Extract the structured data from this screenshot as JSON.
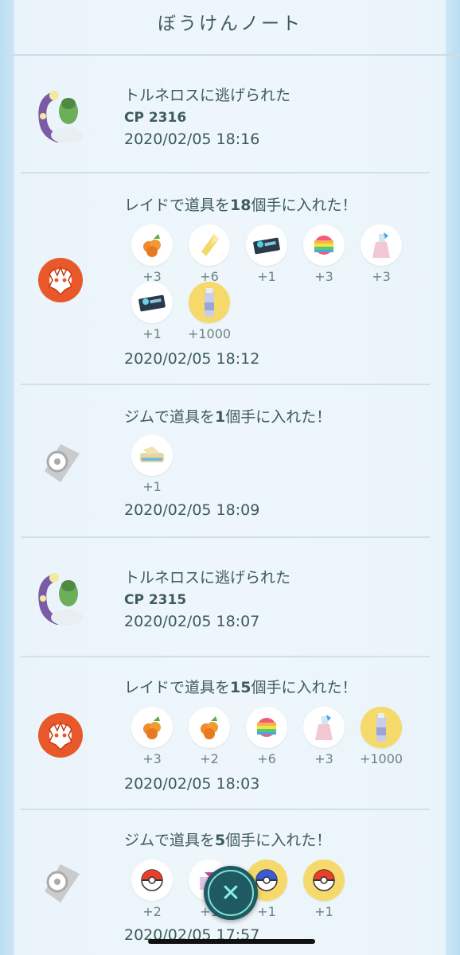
{
  "header": {
    "title": "ぼうけんノート"
  },
  "entries": [
    {
      "type": "flee",
      "pre": "トルネロスに逃げられた",
      "cp": "CP 2316",
      "date": "2020/02/05 18:16"
    },
    {
      "type": "raid",
      "pre": "レイドで道具を",
      "count": "18",
      "post": "個手に入れた！",
      "date": "2020/02/05 18:12",
      "items": [
        {
          "icon": "golden-razz-berry-icon",
          "qty": "+3"
        },
        {
          "icon": "rare-candy-icon",
          "qty": "+6"
        },
        {
          "icon": "technical-machine-icon",
          "qty": "+1"
        },
        {
          "icon": "rare-candy-rainbow-icon",
          "qty": "+3"
        },
        {
          "icon": "max-revive-icon",
          "qty": "+3"
        },
        {
          "icon": "technical-machine-icon",
          "qty": "+1"
        },
        {
          "icon": "stardust-potion-icon",
          "qty": "+1000"
        }
      ]
    },
    {
      "type": "gym",
      "pre": "ジムで道具を",
      "count": "1",
      "post": "個手に入れた！",
      "date": "2020/02/05 18:09",
      "items": [
        {
          "icon": "pinap-berry-icon",
          "qty": "+1"
        }
      ]
    },
    {
      "type": "flee",
      "pre": "トルネロスに逃げられた",
      "cp": "CP 2315",
      "date": "2020/02/05 18:07"
    },
    {
      "type": "raid",
      "pre": "レイドで道具を",
      "count": "15",
      "post": "個手に入れた！",
      "date": "2020/02/05 18:03",
      "items": [
        {
          "icon": "golden-razz-berry-icon",
          "qty": "+3"
        },
        {
          "icon": "golden-razz-berry-icon",
          "qty": "+2"
        },
        {
          "icon": "rare-candy-rainbow-icon",
          "qty": "+6"
        },
        {
          "icon": "max-revive-icon",
          "qty": "+3"
        },
        {
          "icon": "stardust-potion-icon",
          "qty": "+1000"
        }
      ]
    },
    {
      "type": "gym",
      "pre": "ジムで道具を",
      "count": "5",
      "post": "個手に入れた！",
      "date": "2020/02/05 17:57",
      "items": [
        {
          "icon": "poke-ball-icon",
          "qty": "+2"
        },
        {
          "icon": "gift-icon",
          "qty": "+1"
        },
        {
          "icon": "great-ball-icon",
          "qty": "+1"
        },
        {
          "icon": "poke-ball-gold-icon",
          "qty": "+1"
        }
      ]
    }
  ],
  "close_button": {
    "icon": "close-icon"
  },
  "colors": {
    "text": "#3e5b5c",
    "raid_orange": "#e8582a",
    "gold_circle": "#f6d96b",
    "fab": "#1f5a63"
  }
}
